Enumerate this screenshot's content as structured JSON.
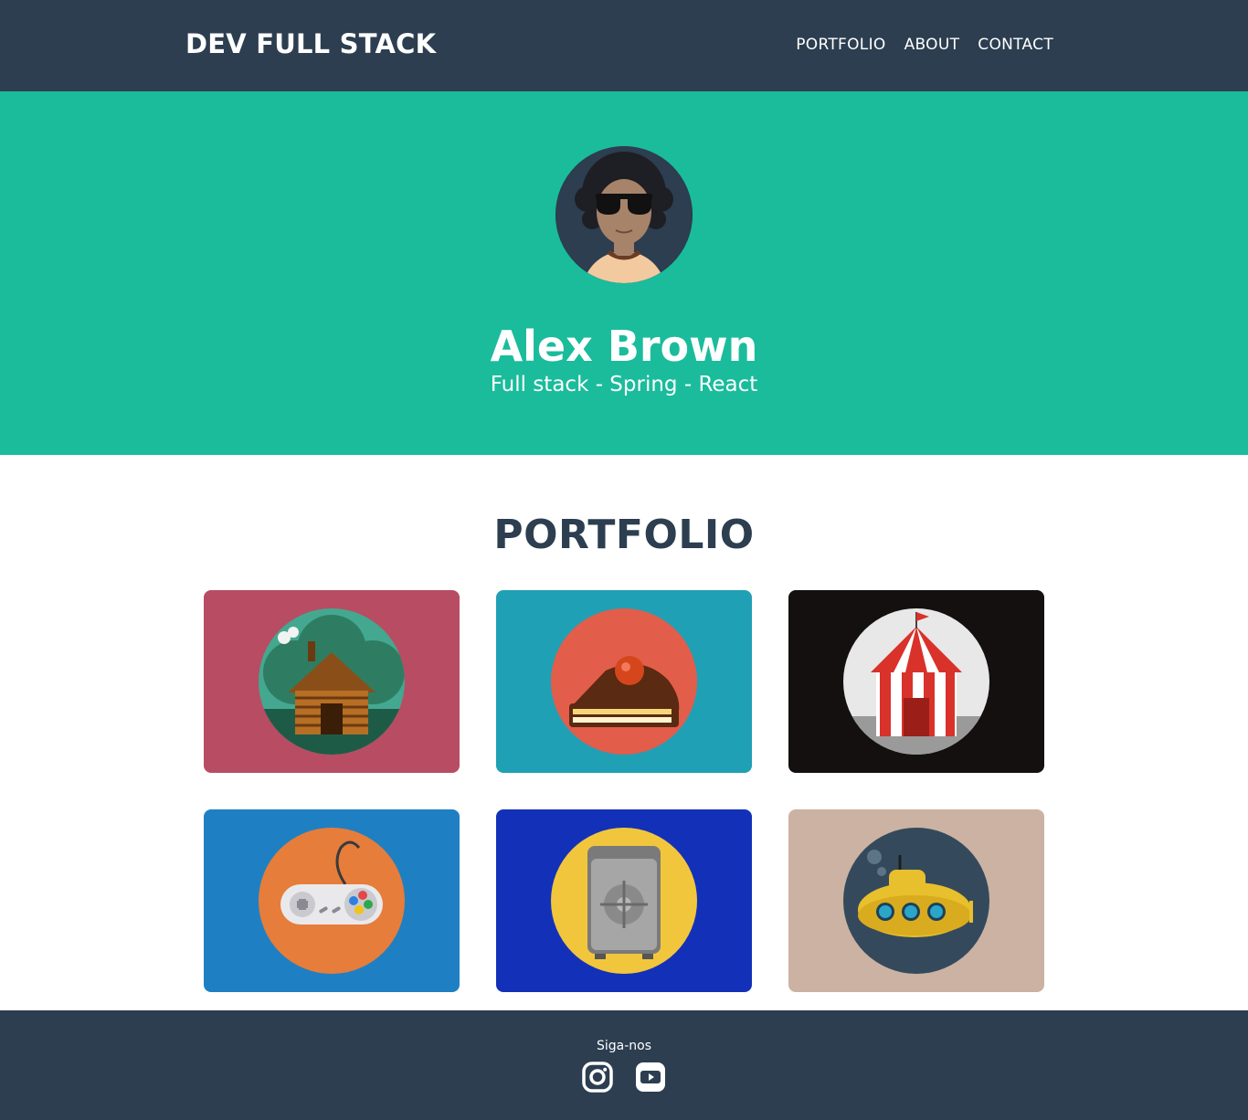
{
  "navbar": {
    "brand": "DEV FULL STACK",
    "links": [
      "PORTFOLIO",
      "ABOUT",
      "CONTACT"
    ]
  },
  "hero": {
    "name": "Alex Brown",
    "subtitle": "Full stack - Spring - React",
    "avatar_icon": "avatar-sunglasses-icon"
  },
  "portfolio": {
    "title": "PORTFOLIO",
    "items": [
      {
        "icon": "cabin-icon",
        "background": "#b84c62",
        "circle": "#43a88f"
      },
      {
        "icon": "cake-icon",
        "background": "#20a0b4",
        "circle": "#e35d4b"
      },
      {
        "icon": "circus-tent-icon",
        "background": "#141010",
        "circle": "#e8e8e8"
      },
      {
        "icon": "game-controller-icon",
        "background": "#1e80c2",
        "circle": "#e67d3a"
      },
      {
        "icon": "safe-icon",
        "background": "#1331b8",
        "circle": "#f1c63d"
      },
      {
        "icon": "submarine-icon",
        "background": "#cbb2a2",
        "circle": "#344a5c"
      }
    ]
  },
  "footer": {
    "follow_text": "Siga-nos",
    "social": [
      "instagram-icon",
      "youtube-icon"
    ]
  },
  "colors": {
    "navbar": "#2c3e50",
    "hero": "#1abc9c",
    "title": "#2c3e50",
    "footer": "#2c3e50"
  }
}
